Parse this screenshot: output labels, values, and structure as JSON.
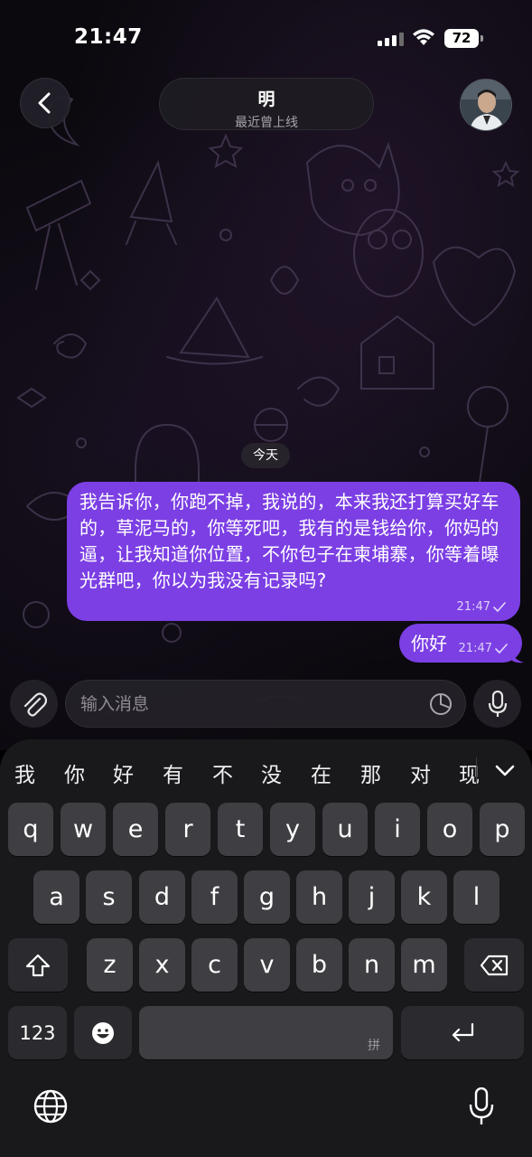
{
  "status_bar": {
    "time": "21:47",
    "battery_level": "72"
  },
  "header": {
    "contact_name": "明",
    "contact_status": "最近曾上线"
  },
  "chat": {
    "date_chip": "今天",
    "messages": [
      {
        "text": "我告诉你，你跑不掉，我说的，本来我还打算买好车的，草泥马的，你等死吧，我有的是钱给你，你妈的逼，让我知道你位置，不你包子在柬埔寨，你等着曝光群吧，你以为我没有记录吗?",
        "time": "21:47",
        "status": "read"
      },
      {
        "text": "你好",
        "time": "21:47",
        "status": "read"
      }
    ]
  },
  "composer": {
    "placeholder": "输入消息"
  },
  "keyboard": {
    "candidates": [
      "我",
      "你",
      "好",
      "有",
      "不",
      "没",
      "在",
      "那",
      "对",
      "现"
    ],
    "row1": [
      "q",
      "w",
      "e",
      "r",
      "t",
      "y",
      "u",
      "i",
      "o",
      "p"
    ],
    "row2": [
      "a",
      "s",
      "d",
      "f",
      "g",
      "h",
      "j",
      "k",
      "l"
    ],
    "row3": [
      "z",
      "x",
      "c",
      "v",
      "b",
      "n",
      "m"
    ],
    "numbers_key": "123",
    "space_hint": "拼",
    "icons": {
      "shift": "shift-icon",
      "delete": "backspace-icon",
      "emoji": "emoji-icon",
      "return": "return-icon",
      "globe": "globe-icon",
      "dictation": "microphone-icon"
    }
  },
  "colors": {
    "outgoing_bubble": "#7b3fe4",
    "keyboard_bg": "#19181b",
    "key_bg": "#3f3e42"
  }
}
